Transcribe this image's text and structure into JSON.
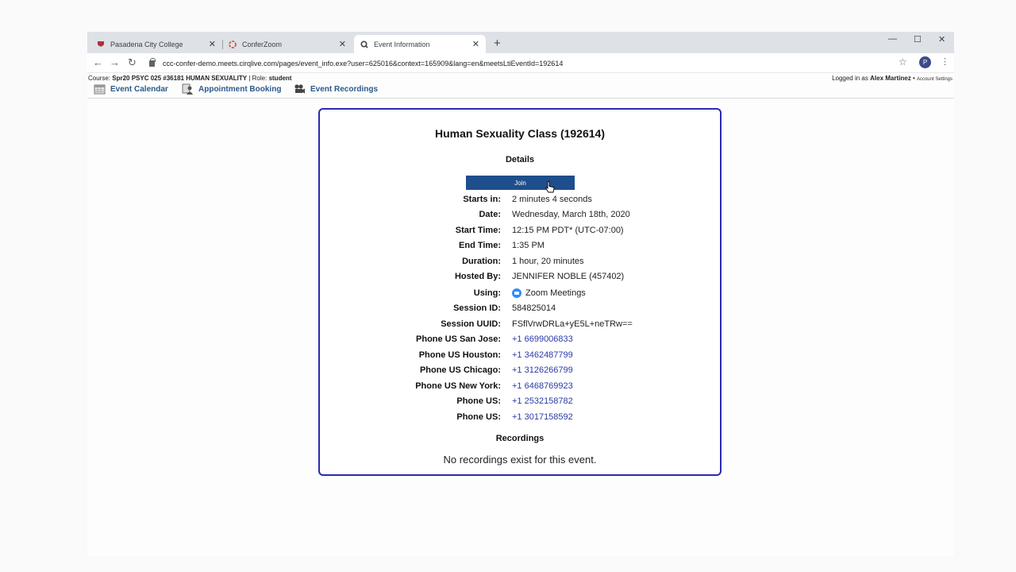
{
  "tabs": [
    {
      "title": "Pasadena City College",
      "active": false,
      "icon": "pcc-logo-icon"
    },
    {
      "title": "ConferZoom",
      "active": false,
      "icon": "conferzoom-icon"
    },
    {
      "title": "Event Information",
      "active": true,
      "icon": "cirqlive-icon"
    }
  ],
  "toolbar": {
    "url": "ccc-confer-demo.meets.cirqlive.com/pages/event_info.exe?user=625016&context=165909&lang=en&meetsLtiEventId=192614",
    "profile_initial": "P"
  },
  "course": {
    "course_label": "Course:",
    "course_name": "Spr20 PSYC 025 #36181 HUMAN SEXUALITY",
    "role_label": "Role:",
    "role": "student",
    "logged_in_label": "Logged in as",
    "user": "Alex Martinez",
    "account_settings": "Account Settings"
  },
  "nav": [
    {
      "label": "Event Calendar",
      "icon": "calendar-icon"
    },
    {
      "label": "Appointment Booking",
      "icon": "person-booking-icon"
    },
    {
      "label": "Event Recordings",
      "icon": "camera-icon"
    }
  ],
  "event": {
    "title": "Human Sexuality Class (192614)",
    "details_heading": "Details",
    "join_label": "Join",
    "fields": [
      {
        "label": "Starts in:",
        "value": "2 minutes 4 seconds"
      },
      {
        "label": "Date:",
        "value": "Wednesday, March 18th, 2020"
      },
      {
        "label": "Start Time:",
        "value": "12:15 PM PDT* (UTC-07:00)"
      },
      {
        "label": "End Time:",
        "value": "1:35 PM"
      },
      {
        "label": "Duration:",
        "value": "1 hour, 20 minutes"
      },
      {
        "label": "Hosted By:",
        "value": "JENNIFER NOBLE (457402)"
      },
      {
        "label": "Using:",
        "value": "Zoom Meetings",
        "icon": "zoom-icon"
      },
      {
        "label": "Session ID:",
        "value": "584825014"
      },
      {
        "label": "Session UUID:",
        "value": "FSflVrwDRLa+yE5L+neTRw=="
      },
      {
        "label": "Phone US San Jose:",
        "value": "+1 6699006833",
        "link": true
      },
      {
        "label": "Phone US Houston:",
        "value": "+1 3462487799",
        "link": true
      },
      {
        "label": "Phone US Chicago:",
        "value": "+1 3126266799",
        "link": true
      },
      {
        "label": "Phone US New York:",
        "value": "+1 6468769923",
        "link": true
      },
      {
        "label": "Phone US:",
        "value": "+1 2532158782",
        "link": true
      },
      {
        "label": "Phone US:",
        "value": "+1 3017158592",
        "link": true
      }
    ],
    "recordings_heading": "Recordings",
    "no_recordings": "No recordings exist for this event."
  },
  "colors": {
    "accent": "#1f4e8c",
    "card_border": "#2b2bb0",
    "link": "#2b3aa8",
    "nav_link": "#2a5a8a"
  }
}
